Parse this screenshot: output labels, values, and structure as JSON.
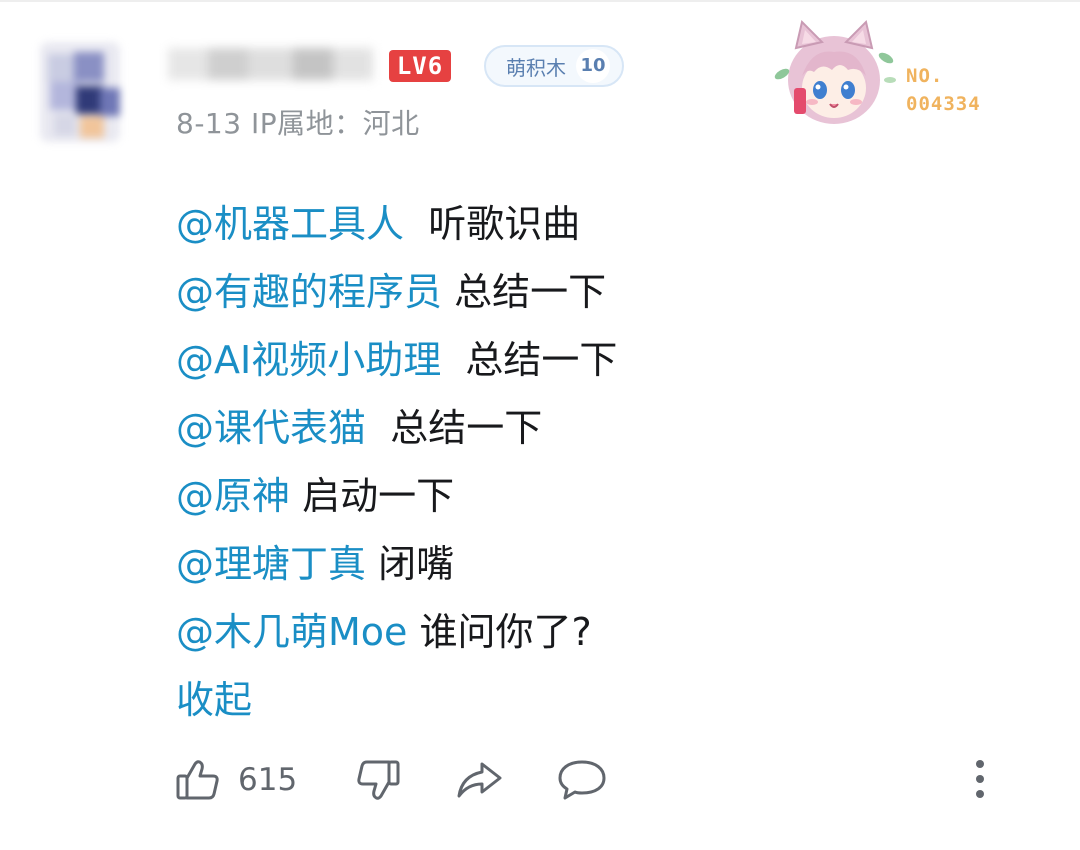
{
  "comment": {
    "user_level": "LV6",
    "fan_badge": {
      "name": "萌积木",
      "level": "10"
    },
    "meta": "8-13 IP属地：河北",
    "decoration": {
      "number_label": "NO.",
      "number": "004334"
    },
    "lines": [
      {
        "mention": "@机器工具人",
        "text": "听歌识曲"
      },
      {
        "mention": "@有趣的程序员",
        "text": "总结一下"
      },
      {
        "mention": "@AI视频小助理",
        "text": "总结一下"
      },
      {
        "mention": "@课代表猫",
        "text": "总结一下"
      },
      {
        "mention": "@原神",
        "text": "启动一下"
      },
      {
        "mention": "@理塘丁真",
        "text": "闭嘴"
      },
      {
        "mention": "@木几萌Moe",
        "text": "谁问你了?"
      }
    ],
    "collapse_label": "收起",
    "like_count": "615"
  },
  "icons": {
    "like": "thumbs-up-icon",
    "dislike": "thumbs-down-icon",
    "share": "share-icon",
    "reply": "comment-icon",
    "more": "more-vertical-icon"
  },
  "colors": {
    "mention": "#1a8ec5",
    "text": "#18191c",
    "meta": "#8f9499",
    "level_badge": "#e64141",
    "fan_badge_text": "#5a7fb0",
    "deco_number": "#f0b35e",
    "icon": "#61666d"
  }
}
